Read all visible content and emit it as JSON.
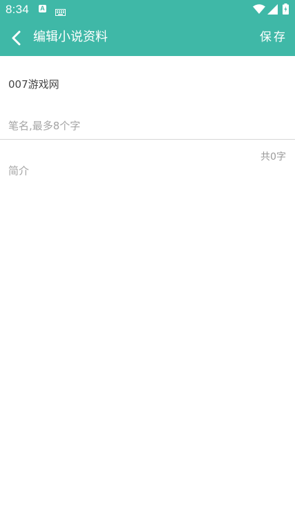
{
  "status_bar": {
    "time": "8:34",
    "notification_a_glyph": "A",
    "icons": [
      "a-notification-icon",
      "keyboard-icon",
      "wifi-icon",
      "signal-icon",
      "battery-icon"
    ],
    "color": "#3fb8a7"
  },
  "app_bar": {
    "title": "编辑小说资料",
    "save_label": "保存",
    "back_icon": "chevron-left-icon",
    "color": "#3fb8a7"
  },
  "form": {
    "site_name": "007游戏网",
    "pen_name": {
      "value": "",
      "placeholder": "笔名,最多8个字"
    },
    "char_count": "共0字",
    "intro": {
      "value": "",
      "placeholder": "简介"
    }
  }
}
